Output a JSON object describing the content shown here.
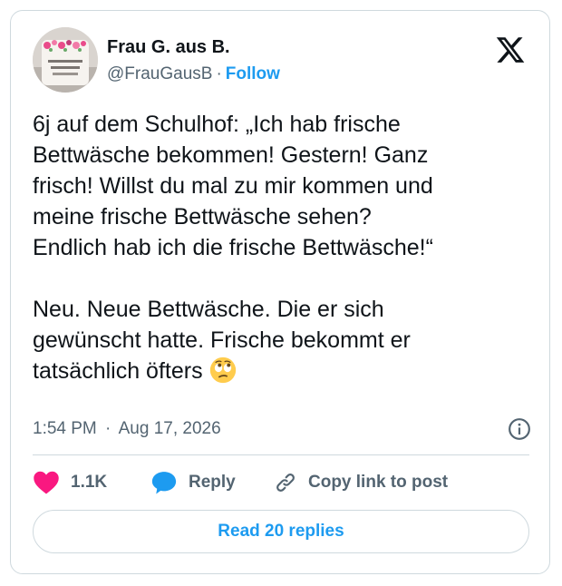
{
  "author": {
    "display_name": "Frau G. aus B.",
    "handle": "@FrauGausB",
    "separator": "·",
    "follow_label": "Follow",
    "avatar": "pink floral mug avatar"
  },
  "platform": {
    "logo_icon": "x-logo-icon"
  },
  "tweet": {
    "paragraph_1": "6j auf dem Schulhof: „Ich hab frische\nBettwäsche bekommen! Gestern! Ganz\nfrisch! Willst du mal zu mir kommen und\nmeine frische Bettwäsche sehen?\nEndlich hab ich die frische Bettwäsche!“",
    "paragraph_2": "Neu. Neue Bettwäsche. Die er sich\ngewünscht hatte. Frische bekommt er\ntatsächlich öfters",
    "emoji": "face-with-rolling-eyes"
  },
  "meta": {
    "time": "1:54 PM",
    "separator": "·",
    "date": "Aug 17, 2026",
    "info_icon": "info-icon"
  },
  "actions": {
    "like_count": "1.1K",
    "reply_label": "Reply",
    "copy_link_label": "Copy link to post"
  },
  "read_replies_label": "Read 20 replies",
  "colors": {
    "accent": "#1d9bf0",
    "like": "#f91880",
    "text": "#0f1419",
    "secondary_text": "#536471",
    "border": "#cfd9de"
  }
}
